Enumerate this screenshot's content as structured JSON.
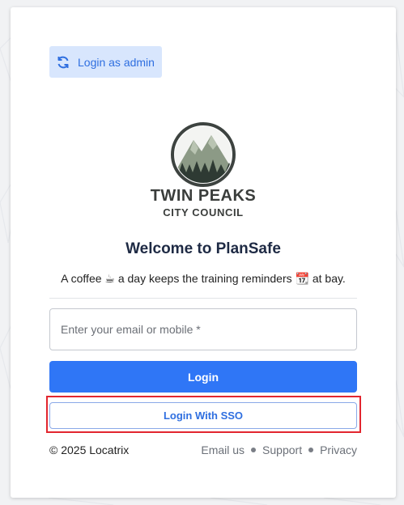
{
  "admin_button": {
    "label": "Login as admin",
    "icon": "refresh-icon"
  },
  "logo": {
    "title": "TWIN PEAKS",
    "subtitle": "CITY COUNCIL"
  },
  "welcome": "Welcome to PlanSafe",
  "tagline": "A coffee ☕ a day keeps the training reminders 📆 at bay.",
  "form": {
    "email_placeholder": "Enter your email or mobile *",
    "login_label": "Login",
    "sso_label": "Login With SSO"
  },
  "footer": {
    "copyright": "© 2025 Locatrix",
    "links": [
      "Email us",
      "Support",
      "Privacy"
    ]
  },
  "colors": {
    "primary": "#2f76f6",
    "highlight": "#e2262f",
    "admin_bg": "#d8e6fd"
  }
}
